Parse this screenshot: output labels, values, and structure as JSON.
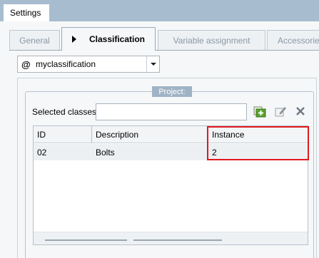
{
  "window": {
    "title": "Settings"
  },
  "tabs": [
    {
      "label": "General"
    },
    {
      "label": "Classification"
    },
    {
      "label": "Variable assignment"
    },
    {
      "label": "Accessories"
    }
  ],
  "classification_select": {
    "icon": "@",
    "value": "myclassification"
  },
  "project": {
    "label": "Project:",
    "selected_classes_label": "Selected classes",
    "selected_classes_value": ""
  },
  "grid": {
    "columns": [
      "ID",
      "Description",
      "Instance"
    ],
    "rows": [
      {
        "id": "02",
        "description": "Bolts",
        "instance": "2"
      }
    ]
  },
  "colors": {
    "titlebar": "#a7bccf",
    "highlight": "#e0191e",
    "project_label_bg": "#9fb3c5"
  }
}
